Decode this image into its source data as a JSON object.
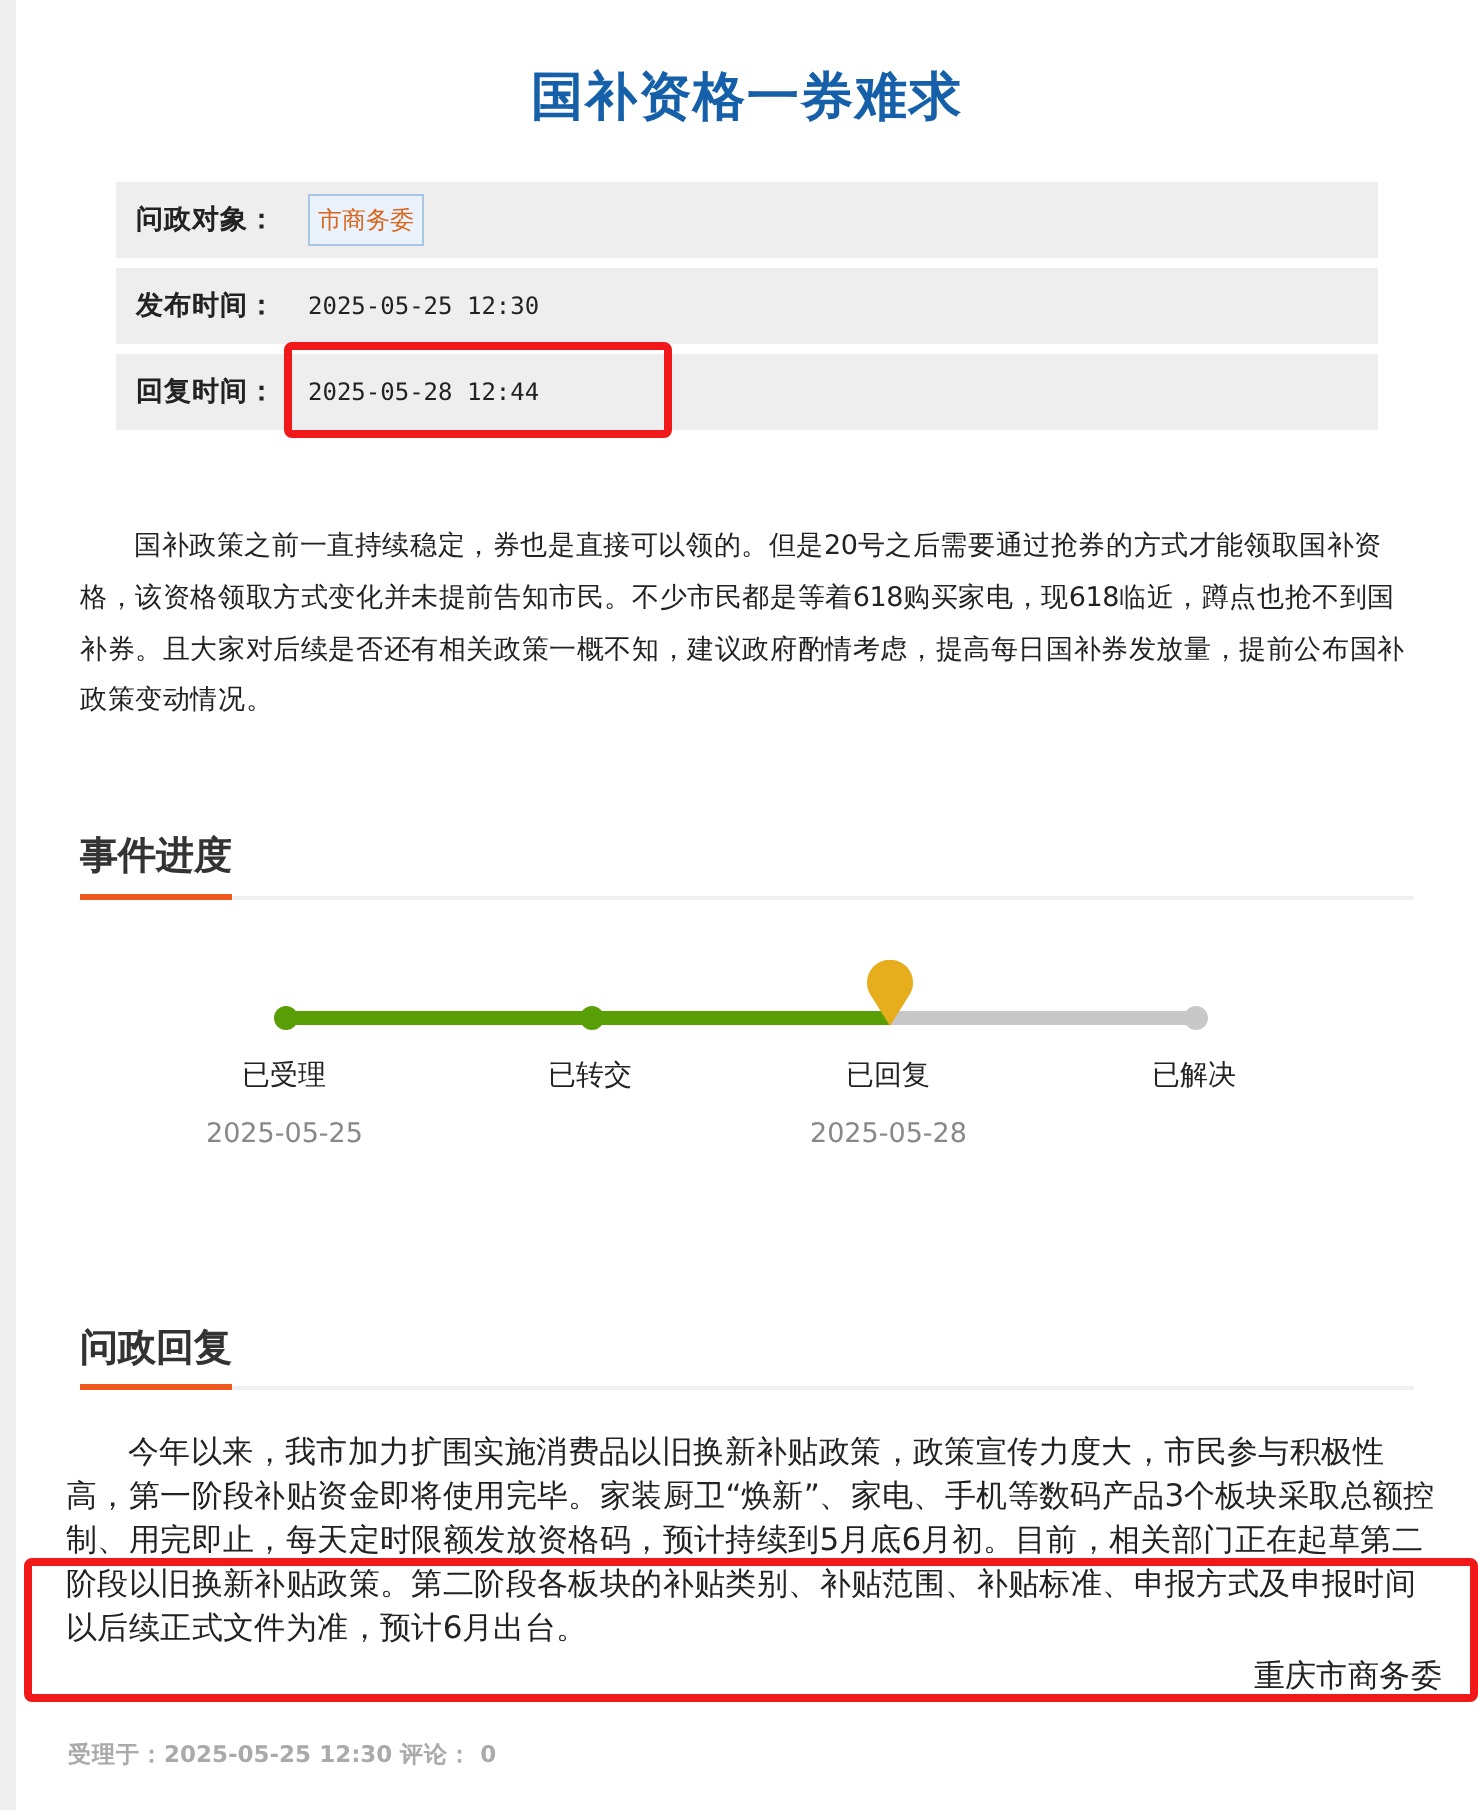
{
  "title": "国补资格一券难求",
  "meta": [
    {
      "label": "问政对象：",
      "value": "市商务委",
      "kind": "tag",
      "highlighted": false
    },
    {
      "label": "发布时间：",
      "value": "2025-05-25 12:30",
      "kind": "text",
      "highlighted": false
    },
    {
      "label": "回复时间：",
      "value": "2025-05-28 12:44",
      "kind": "text",
      "highlighted": true
    }
  ],
  "question": "国补政策之前一直持续稳定，券也是直接可以领的。但是20号之后需要通过抢券的方式才能领取国补资格，该资格领取方式变化并未提前告知市民。不少市民都是等着618购买家电，现618临近，蹲点也抢不到国补券。且大家对后续是否还有相关政策一概不知，建议政府酌情考虑，提高每日国补券发放量，提前公布国补政策变动情况。",
  "progress": {
    "heading": "事件进度",
    "steps": [
      {
        "label": "已受理",
        "date": "2025-05-25",
        "reached": true,
        "current": false
      },
      {
        "label": "已转交",
        "reached": true,
        "current": false
      },
      {
        "label": "已回复",
        "date": "2025-05-28",
        "reached": true,
        "current": true
      },
      {
        "label": "已解决",
        "reached": false,
        "current": false
      }
    ]
  },
  "reply": {
    "heading": "问政回复",
    "text": "今年以来，我市加力扩围实施消费品以旧换新补贴政策，政策宣传力度大，市民参与积极性高，第一阶段补贴资金即将使用完毕。家装厨卫“焕新”、家电、手机等数码产品3个板块采取总额控制、用完即止，每天定时限额发放资格码，预计持续到5月底6月初。目前，相关部门正在起草第二阶段以旧换新补贴政策。第二阶段各板块的补贴类别、补贴范围、补贴标准、申报方式及申报时间以后续正式文件为准，预计6月出台。",
    "signature": "重庆市商务委",
    "highlighted": true
  },
  "footer": "受理于：2025-05-25 12:30 评论： 0"
}
